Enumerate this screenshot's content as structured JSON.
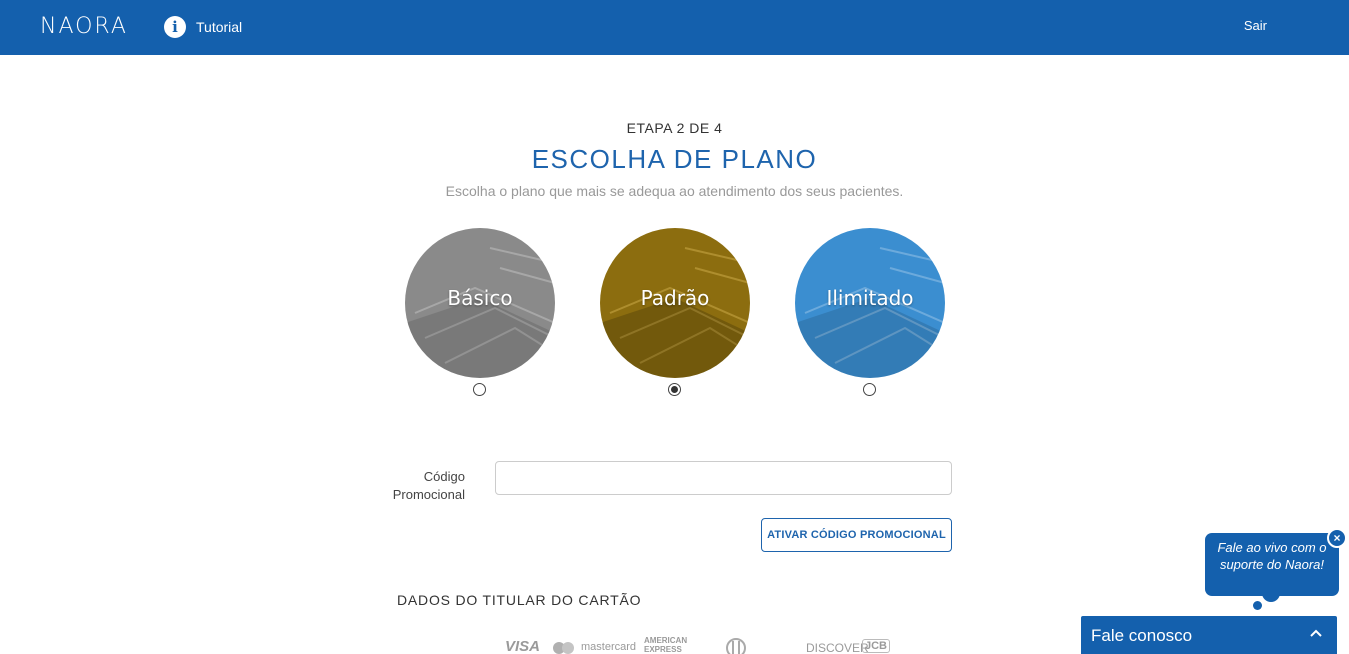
{
  "header": {
    "logo_text": "NAORA",
    "tutorial_label": "Tutorial",
    "logout_label": "Sair",
    "background_color": "#1460ad",
    "info_icon": "info-icon"
  },
  "main": {
    "step_label": "ETAPA 2 DE 4",
    "title": "ESCOLHA DE PLANO",
    "subtitle": "Escolha o plano que mais se adequa ao atendimento dos seus pacientes."
  },
  "plans": [
    {
      "label": "Básico",
      "color": "#8a8a8a",
      "selected": false
    },
    {
      "label": "Padrão",
      "color": "#8c6d0f",
      "selected": true
    },
    {
      "label": "Ilimitado",
      "color": "#3b8ed0",
      "selected": false
    }
  ],
  "promo": {
    "label_line1": "Código",
    "label_line2": "Promocional",
    "input_value": "",
    "input_placeholder": "",
    "button_label": "ATIVAR CÓDIGO PROMOCIONAL"
  },
  "cardholder": {
    "section_title": "DADOS DO TITULAR DO CARTÃO",
    "card_brands": [
      "VISA",
      "mastercard",
      "AMERICAN EXPRESS",
      "Diners",
      "DISCOVER",
      "JCB"
    ]
  },
  "chat": {
    "bubble_text": "Fale ao vivo com o suporte do Naora!",
    "close_symbol": "×",
    "bar_label": "Fale conosco",
    "chevron": "⌃"
  }
}
